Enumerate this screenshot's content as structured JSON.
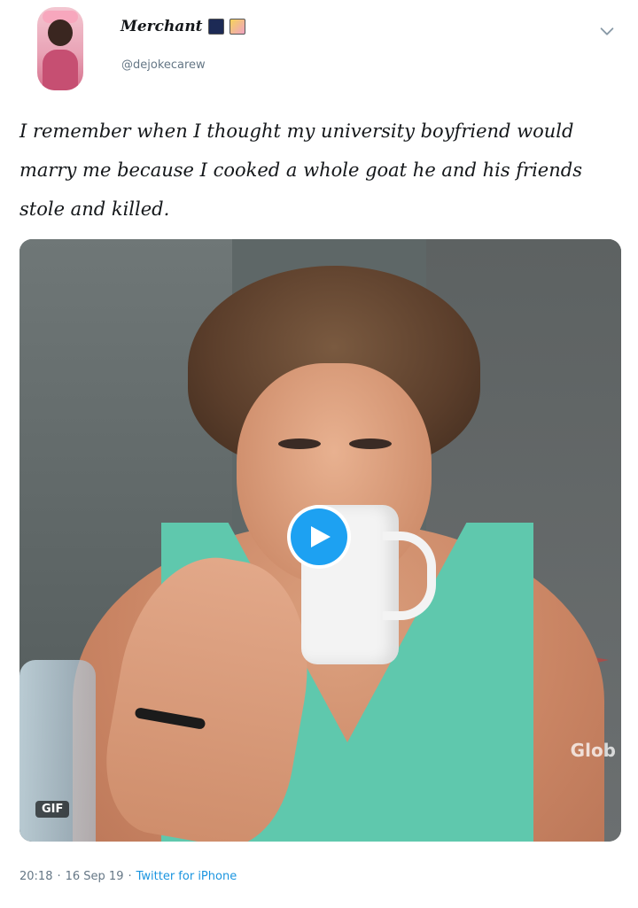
{
  "author": {
    "display_name": "Merchant",
    "handle": "@dejokecarew",
    "avatar_icon": "profile-photo",
    "name_emojis": [
      "sailboat-emoji",
      "shopping-bags-emoji"
    ]
  },
  "menu": {
    "icon": "chevron-down-icon"
  },
  "tweet": {
    "text": "I remember when I thought my university boyfriend would marry me because I cooked a whole goat he and his friends stole and killed."
  },
  "media": {
    "type": "gif",
    "badge": "GIF",
    "play_icon": "play-icon",
    "watermark": "Glob",
    "accent": "#1da1f2"
  },
  "meta": {
    "time": "20:18",
    "date": "16 Sep 19",
    "separator": "·",
    "source": "Twitter for iPhone"
  },
  "colors": {
    "text": "#14171a",
    "secondary": "#657786",
    "link": "#1b95e0"
  }
}
